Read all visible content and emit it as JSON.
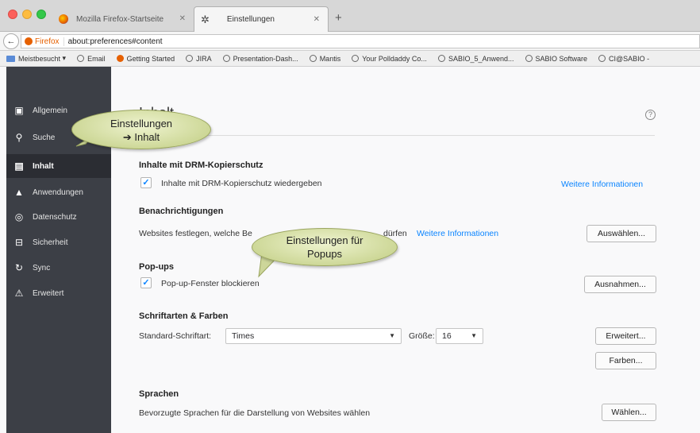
{
  "tabs": [
    {
      "label": "Mozilla Firefox-Startseite"
    },
    {
      "label": "Einstellungen"
    }
  ],
  "urlbar": {
    "identity": "Firefox",
    "url": "about:preferences#content"
  },
  "bookmarks": [
    "Meistbesucht",
    "Email",
    "Getting Started",
    "JIRA",
    "Presentation-Dash...",
    "Mantis",
    "Your Polldaddy Co...",
    "SABIO_5_Anwend...",
    "SABIO Software",
    "CI@SABIO -"
  ],
  "sidebar": {
    "items": [
      {
        "label": "Allgemein",
        "icon": "general-icon"
      },
      {
        "label": "Suche",
        "icon": "search-icon"
      },
      {
        "label": "Inhalt",
        "icon": "content-icon"
      },
      {
        "label": "Anwendungen",
        "icon": "applications-icon"
      },
      {
        "label": "Datenschutz",
        "icon": "privacy-mask-icon"
      },
      {
        "label": "Sicherheit",
        "icon": "lock-icon"
      },
      {
        "label": "Sync",
        "icon": "sync-icon"
      },
      {
        "label": "Erweitert",
        "icon": "advanced-icon"
      }
    ],
    "active_index": 2
  },
  "main": {
    "heading": "Inhalt",
    "drm": {
      "title": "Inhalte mit DRM-Kopierschutz",
      "checkbox_label": "Inhalte mit DRM-Kopierschutz wiedergeben",
      "checked": true,
      "link": "Weitere Informationen"
    },
    "notifications": {
      "title": "Benachrichtigungen",
      "text_start": "Websites festlegen, welche Be",
      "text_end": "dürfen",
      "link": "Weitere Informationen",
      "button": "Auswählen..."
    },
    "popups": {
      "title": "Pop-ups",
      "checkbox_label": "Pop-up-Fenster blockieren",
      "checked": true,
      "button": "Ausnahmen..."
    },
    "fonts": {
      "title": "Schriftarten & Farben",
      "standard_label": "Standard-Schriftart:",
      "font_value": "Times",
      "size_label": "Größe:",
      "size_value": "16",
      "advanced_button": "Erweitert...",
      "colors_button": "Farben..."
    },
    "languages": {
      "title": "Sprachen",
      "text": "Bevorzugte Sprachen für die Darstellung von Websites wählen",
      "button": "Wählen..."
    }
  },
  "callouts": {
    "settings_content": {
      "line1": "Einstellungen",
      "line2": "➔ Inhalt"
    },
    "popup_settings": {
      "line1": "Einstellungen für",
      "line2": "Popups"
    }
  },
  "colors": {
    "sidebar_bg": "#3c3f46",
    "link": "#0a84ff",
    "callout": "#d7dea6"
  }
}
